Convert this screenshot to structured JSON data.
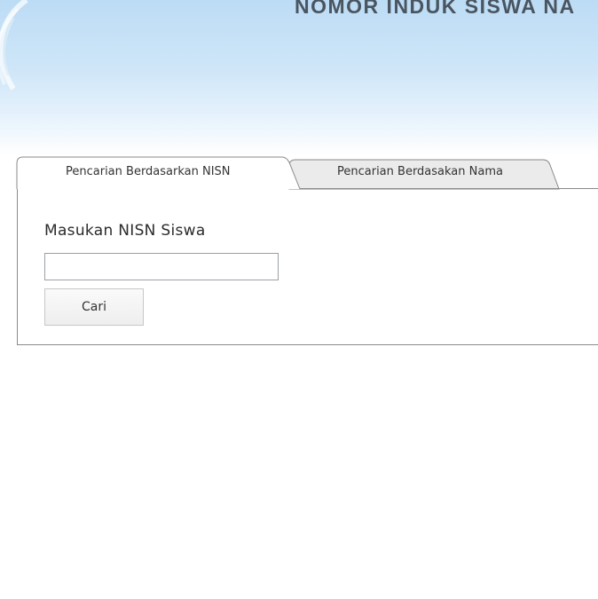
{
  "header": {
    "title": "NOMOR INDUK SISWA NA"
  },
  "tabs": [
    {
      "label": "Pencarian Berdasarkan NISN",
      "active": true
    },
    {
      "label": "Pencarian Berdasakan Nama",
      "active": false
    }
  ],
  "form": {
    "label": "Masukan NISN Siswa",
    "input_value": "",
    "input_placeholder": "",
    "button_label": "Cari"
  },
  "colors": {
    "banner_top": "#bcdcf5",
    "panel_border": "#8a8a8a",
    "inactive_tab": "#ebebeb"
  }
}
